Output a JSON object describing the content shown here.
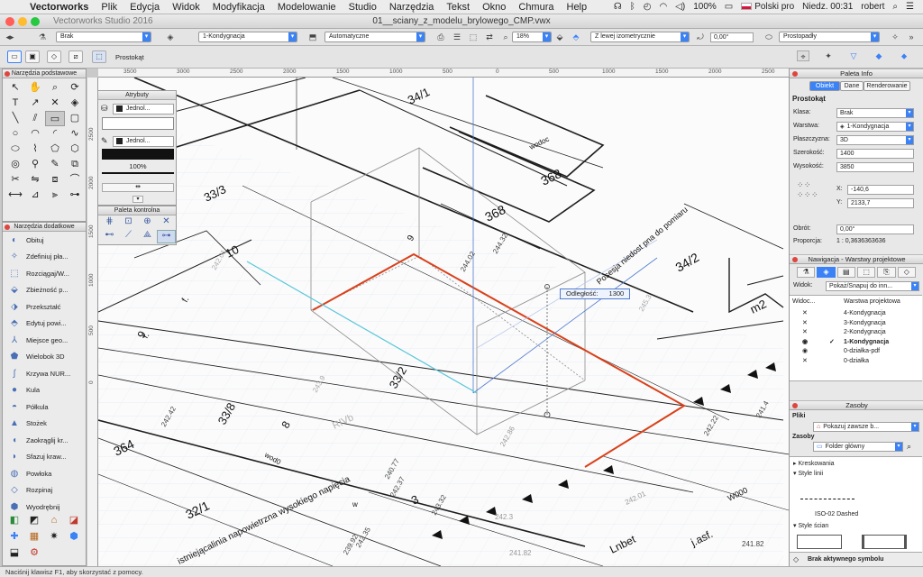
{
  "menubar": {
    "app_name": "Vectorworks",
    "items": [
      "Plik",
      "Edycja",
      "Widok",
      "Modyfikacja",
      "Modelowanie",
      "Studio",
      "Narzędzia",
      "Tekst",
      "Okno",
      "Chmura",
      "Help"
    ],
    "battery": "100%",
    "input_source": "Polski pro",
    "clock": "Niedz. 00:31",
    "user": "robert"
  },
  "window": {
    "app_title": "Vectorworks Studio 2016",
    "document_title": "01__sciany_z_modelu_brylowego_CMP.vwx"
  },
  "view_bar": {
    "class": "Brak",
    "layer": "1-Kondygnacja",
    "render_mode": "Automatyczne",
    "zoom": "18%",
    "view": "Z lewej izometrycznie",
    "angle": "0,00°",
    "projection": "Prostopadły"
  },
  "mode_bar": {
    "tool_name": "Prostokąt"
  },
  "basic_tools": {
    "title": "Narzędzia podstawowe",
    "tools": [
      {
        "icon": "arrow-icon",
        "glyph": "↖"
      },
      {
        "icon": "hand-icon",
        "glyph": "✋"
      },
      {
        "icon": "zoom-icon",
        "glyph": "⌕"
      },
      {
        "icon": "flyover-icon",
        "glyph": "⟳"
      },
      {
        "icon": "text-icon",
        "glyph": "T"
      },
      {
        "icon": "callout-icon",
        "glyph": "↗"
      },
      {
        "icon": "locus-icon",
        "glyph": "✕"
      },
      {
        "icon": "layer-icon",
        "glyph": "◈"
      },
      {
        "icon": "line-icon",
        "glyph": "╲"
      },
      {
        "icon": "double-line-icon",
        "glyph": "⫽"
      },
      {
        "icon": "rectangle-icon",
        "glyph": "▭"
      },
      {
        "icon": "rounded-rect-icon",
        "glyph": "▢"
      },
      {
        "icon": "circle-icon",
        "glyph": "○"
      },
      {
        "icon": "arc-icon",
        "glyph": "◠"
      },
      {
        "icon": "quarter-arc-icon",
        "glyph": "◜"
      },
      {
        "icon": "freehand-icon",
        "glyph": "∿"
      },
      {
        "icon": "oval-icon",
        "glyph": "⬭"
      },
      {
        "icon": "polyline-icon",
        "glyph": "⌇"
      },
      {
        "icon": "polygon-icon",
        "glyph": "⬠"
      },
      {
        "icon": "double-polygon-icon",
        "glyph": "⬡"
      },
      {
        "icon": "spiral-icon",
        "glyph": "◎"
      },
      {
        "icon": "eyedropper-icon",
        "glyph": "⚲"
      },
      {
        "icon": "paint-icon",
        "glyph": "✎"
      },
      {
        "icon": "attribute-icon",
        "glyph": "⧉"
      },
      {
        "icon": "clip-icon",
        "glyph": "✂"
      },
      {
        "icon": "mirror-icon",
        "glyph": "⇋"
      },
      {
        "icon": "offset-icon",
        "glyph": "⧈"
      },
      {
        "icon": "fillet-icon",
        "glyph": "⌒"
      },
      {
        "icon": "dim-icon",
        "glyph": "⟷"
      },
      {
        "icon": "constrain-icon",
        "glyph": "⊿"
      },
      {
        "icon": "split-icon",
        "glyph": "⫸"
      },
      {
        "icon": "connect-icon",
        "glyph": "⊶"
      }
    ]
  },
  "attributes": {
    "title": "Atrybuty",
    "fill_label": "Jednol...",
    "pen_label": "Jednol...",
    "opacity": "100%"
  },
  "snap_palette": {
    "title": "Paleta kontrolna"
  },
  "extra_tools": {
    "title": "Narzędzia dodatkowe",
    "items": [
      {
        "label": "Obituj",
        "icon": "bow-icon",
        "glyph": "◐"
      },
      {
        "label": "Zdefiniuj pła...",
        "icon": "plane-icon",
        "glyph": "✧"
      },
      {
        "label": "Rozciągaj/W...",
        "icon": "stretch-icon",
        "glyph": "⬚"
      },
      {
        "label": "Zbieżność p...",
        "icon": "taper-icon",
        "glyph": "⬙"
      },
      {
        "label": "Przekształć",
        "icon": "transform-icon",
        "glyph": "⬗"
      },
      {
        "label": "Edytuj powi...",
        "icon": "edit-face-icon",
        "glyph": "⬘"
      },
      {
        "label": "Miejsce geo...",
        "icon": "geo-icon",
        "glyph": "⅄"
      },
      {
        "label": "Wielobok 3D",
        "icon": "polygon3d-icon",
        "glyph": "⬟"
      },
      {
        "label": "Krzywa NUR...",
        "icon": "nurbs-icon",
        "glyph": "∫"
      },
      {
        "label": "Kula",
        "icon": "sphere-icon",
        "glyph": "●"
      },
      {
        "label": "Półkula",
        "icon": "hemisphere-icon",
        "glyph": "◓"
      },
      {
        "label": "Stożek",
        "icon": "cone-icon",
        "glyph": "▲"
      },
      {
        "label": "Zaokrąglij kr...",
        "icon": "fillet-edge-icon",
        "glyph": "◖"
      },
      {
        "label": "Sfazuj kraw...",
        "icon": "chamfer-icon",
        "glyph": "◗"
      },
      {
        "label": "Powłoka",
        "icon": "shell-icon",
        "glyph": "◍"
      },
      {
        "label": "Rozpinaj",
        "icon": "loft-icon",
        "glyph": "◇"
      },
      {
        "label": "Wyodrębnij",
        "icon": "extract-icon",
        "glyph": "⬢"
      }
    ]
  },
  "hruler_ticks": [
    "3500",
    "3000",
    "2500",
    "2000",
    "1500",
    "1000",
    "500",
    "0",
    "500",
    "1000",
    "1500",
    "2000",
    "2500"
  ],
  "vruler_ticks": [
    "2500",
    "2000",
    "1500",
    "1000",
    "500",
    "0"
  ],
  "canvas": {
    "parcels": [
      "34/1",
      "368",
      "368",
      "33/3",
      "10",
      "34/2",
      "33/2",
      "33/8",
      "364",
      "32/1",
      "9",
      "8",
      "3",
      "m2"
    ],
    "spot_heights": [
      "244.32",
      "244.02",
      "242.86",
      "242.22",
      "241.4",
      "240.77",
      "242.37",
      "242.35",
      "239.92",
      "243.32",
      "242.42",
      "242.3",
      "241.82",
      "243.9",
      "242.01",
      "241.82",
      "242.01",
      "245.3"
    ],
    "labels": [
      "Posesja niedost pna do pomiaru",
      "RIVb",
      "wod0",
      "wodoc",
      "Lnbet",
      "j.asf.",
      "istniejącalinia napowietrzna wysokiego napięcia",
      "f.",
      "f.",
      "w",
      "9",
      "W000"
    ],
    "dimension_popup": {
      "label": "Odległość:",
      "value": "1300"
    }
  },
  "info_palette": {
    "title": "Paleta Info",
    "tabs": [
      "Obiekt",
      "Dane",
      "Renderowanie"
    ],
    "active_tab": "Obiekt",
    "object_type": "Prostokąt",
    "fields": [
      {
        "label": "Klasa:",
        "value": "Brak"
      },
      {
        "label": "Warstwa:",
        "value": "1-Kondygnacja"
      },
      {
        "label": "Płaszczyzna:",
        "value": "3D"
      },
      {
        "label": "Szerokość:",
        "value": "1400"
      },
      {
        "label": "Wysokość:",
        "value": "3850"
      }
    ],
    "x_label": "X:",
    "x_value": "-140,6",
    "y_label": "Y:",
    "y_value": "2133,7",
    "rotation_label": "Obrót:",
    "rotation_value": "0,00°",
    "ratio_label": "Proporcja:",
    "ratio_value": "1 : 0,3636363636"
  },
  "navigation": {
    "title": "Nawigacja - Warstwy projektowe",
    "view_label": "Widok:",
    "view_value": "Pokaż/Snapuj do inn...",
    "col_visibility": "Widoc...",
    "col_layer": "Warstwa projektowa",
    "layers": [
      {
        "name": "4-Kondygnacja",
        "vis": "✕",
        "active": false
      },
      {
        "name": "3-Kondygnacja",
        "vis": "✕",
        "active": false
      },
      {
        "name": "2-Kondygnacja",
        "vis": "✕",
        "active": false
      },
      {
        "name": "1-Kondygnacja",
        "vis": "◉",
        "active": true
      },
      {
        "name": "0-działka-pdf",
        "vis": "◉",
        "active": false
      },
      {
        "name": "0-działka",
        "vis": "✕",
        "active": false
      }
    ]
  },
  "resources": {
    "title": "Zasoby",
    "files_label": "Pliki",
    "files_value": "Pokazuj zawsze b...",
    "resources_label": "Zasoby",
    "folder_value": "Folder główny",
    "groups": [
      "Kreskowania",
      "Style linii",
      "Style ścian"
    ],
    "line_style_name": "ISO-02 Dashed",
    "no_symbol": "Brak aktywnego symbolu"
  },
  "status": {
    "hint": "Naciśnij klawisz F1, aby skorzystać z pomocy."
  },
  "colors": {
    "accent": "#3b82f6",
    "selection": "#d9411b",
    "grid": "#dde6f0"
  }
}
